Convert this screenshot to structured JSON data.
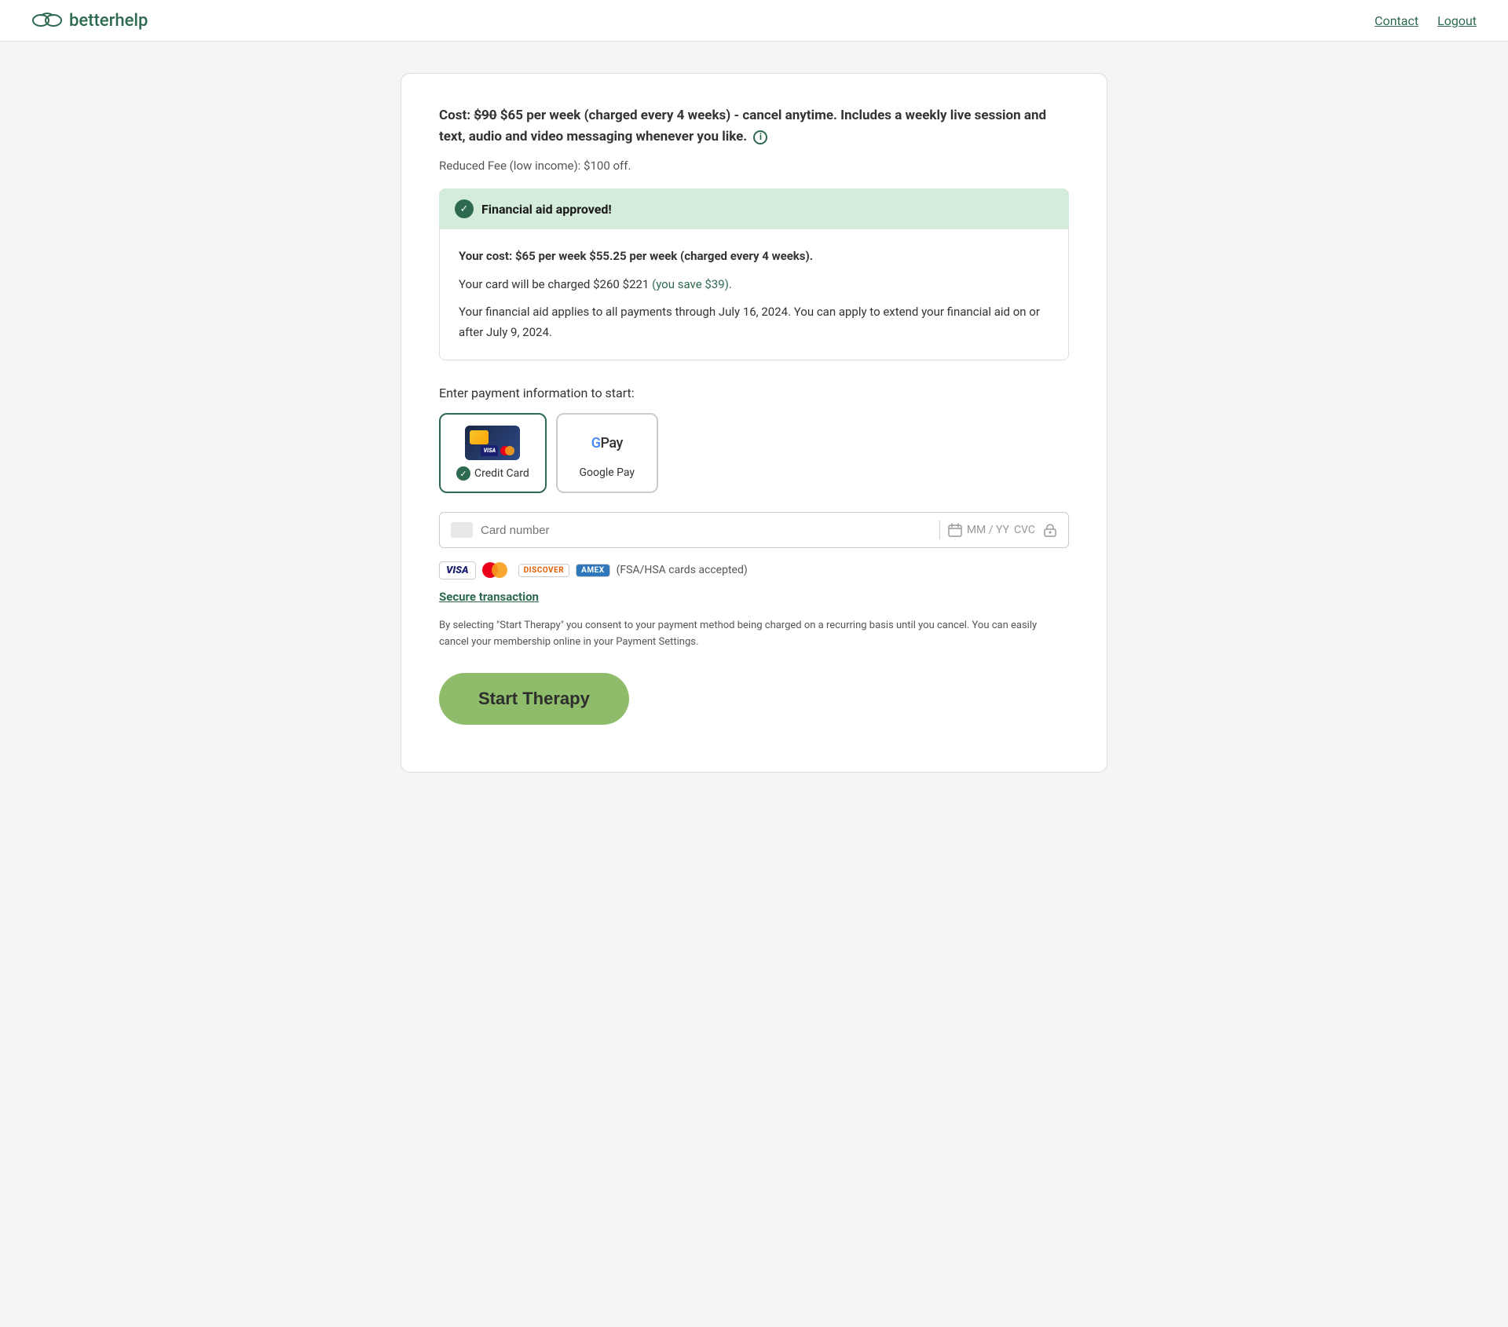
{
  "header": {
    "logo_text": "betterhelp",
    "nav": {
      "contact_label": "Contact",
      "logout_label": "Logout"
    }
  },
  "main": {
    "cost_line_original": "$90",
    "cost_line_current": "$65 per week (charged every 4 weeks) - cancel anytime. Includes a weekly live session and text, audio and video messaging whenever you like.",
    "cost_prefix": "Cost:",
    "reduced_fee": "Reduced Fee (low income): $100 off.",
    "financial_aid_banner": "Financial aid approved!",
    "your_cost_label": "Your cost:",
    "your_cost_original": "$65 per week",
    "your_cost_current": "$55.25 per week (charged every 4 weeks).",
    "charge_line_prefix": "Your card will be charged",
    "charge_original": "$260",
    "charge_current": "$221",
    "savings": "(you save $39).",
    "financial_aid_note": "Your financial aid applies to all payments through July 16, 2024. You can apply to extend your financial aid on or after July 9, 2024.",
    "payment_label": "Enter payment information to start:",
    "payment_options": [
      {
        "id": "credit-card",
        "label": "Credit Card",
        "selected": true
      },
      {
        "id": "google-pay",
        "label": "Google Pay",
        "selected": false
      }
    ],
    "card_number_placeholder": "Card number",
    "card_expiry_placeholder": "MM / YY",
    "card_cvc_placeholder": "CVC",
    "fsa_text": "(FSA/HSA cards accepted)",
    "secure_link": "Secure transaction",
    "consent_text": "By selecting \"Start Therapy\" you consent to your payment method being charged on a recurring basis until you cancel. You can easily cancel your membership online in your Payment Settings.",
    "start_therapy_label": "Start Therapy"
  }
}
